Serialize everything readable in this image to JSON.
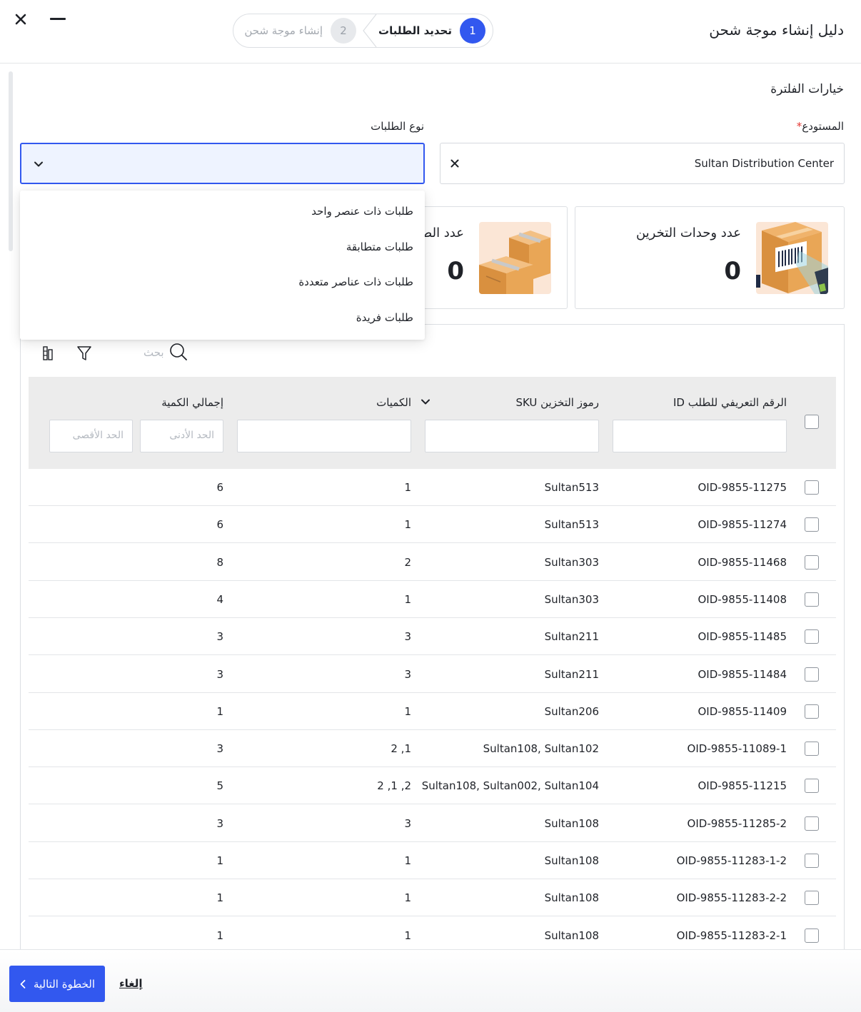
{
  "header": {
    "title": "دليل إنشاء موجة شحن",
    "steps": [
      {
        "number": "1",
        "label": "تحديد الطلبات",
        "active": true
      },
      {
        "number": "2",
        "label": "إنشاء موجة شحن",
        "active": false
      }
    ]
  },
  "filters": {
    "title": "خيارات الفلترة",
    "warehouse_label": "المستودع",
    "required_mark": "*",
    "warehouse_value": "Sultan Distribution Center",
    "order_type_label": "نوع الطلبات",
    "order_type_value": ""
  },
  "dropdown": {
    "options": [
      "طلبات ذات عنصر واحد",
      "طلبات متطابقة",
      "طلبات ذات عناصر متعددة",
      "طلبات فريدة"
    ]
  },
  "stats": [
    {
      "label": "عدد وحدات التخرين",
      "value": "0"
    },
    {
      "label": "عدد الطلبات",
      "value": "0"
    }
  ],
  "table": {
    "search_placeholder": "بحث",
    "columns": {
      "order_id": "الرقم التعريفي للطلب ID",
      "sku": "رموز التخزين SKU",
      "quantities": "الكميات",
      "total_qty": "إجمالي الكمية",
      "min_placeholder": "الحد الأدنى",
      "max_placeholder": "الحد الأقصى"
    },
    "rows": [
      {
        "order_id": "OID-9855-11275",
        "sku": "Sultan513",
        "qty": "1",
        "total": "6"
      },
      {
        "order_id": "OID-9855-11274",
        "sku": "Sultan513",
        "qty": "1",
        "total": "6"
      },
      {
        "order_id": "OID-9855-11468",
        "sku": "Sultan303",
        "qty": "2",
        "total": "8"
      },
      {
        "order_id": "OID-9855-11408",
        "sku": "Sultan303",
        "qty": "1",
        "total": "4"
      },
      {
        "order_id": "OID-9855-11485",
        "sku": "Sultan211",
        "qty": "3",
        "total": "3"
      },
      {
        "order_id": "OID-9855-11484",
        "sku": "Sultan211",
        "qty": "3",
        "total": "3"
      },
      {
        "order_id": "OID-9855-11409",
        "sku": "Sultan206",
        "qty": "1",
        "total": "1"
      },
      {
        "order_id": "OID-9855-11089-1",
        "sku": "Sultan108, Sultan102",
        "qty": "2 ,1",
        "total": "3"
      },
      {
        "order_id": "OID-9855-11215",
        "sku": "Sultan108, Sultan002, Sultan104",
        "qty": "2 ,1 ,2",
        "total": "5"
      },
      {
        "order_id": "OID-9855-11285-2",
        "sku": "Sultan108",
        "qty": "3",
        "total": "3"
      },
      {
        "order_id": "OID-9855-11283-1-2",
        "sku": "Sultan108",
        "qty": "1",
        "total": "1"
      },
      {
        "order_id": "OID-9855-11283-2-2",
        "sku": "Sultan108",
        "qty": "1",
        "total": "1"
      },
      {
        "order_id": "OID-9855-11283-2-1",
        "sku": "Sultan108",
        "qty": "1",
        "total": "1"
      }
    ]
  },
  "footer": {
    "next_label": "الخطوة التالية",
    "cancel_label": "إلغاء"
  },
  "colors": {
    "accent": "#3258ef",
    "required": "#e53935"
  }
}
